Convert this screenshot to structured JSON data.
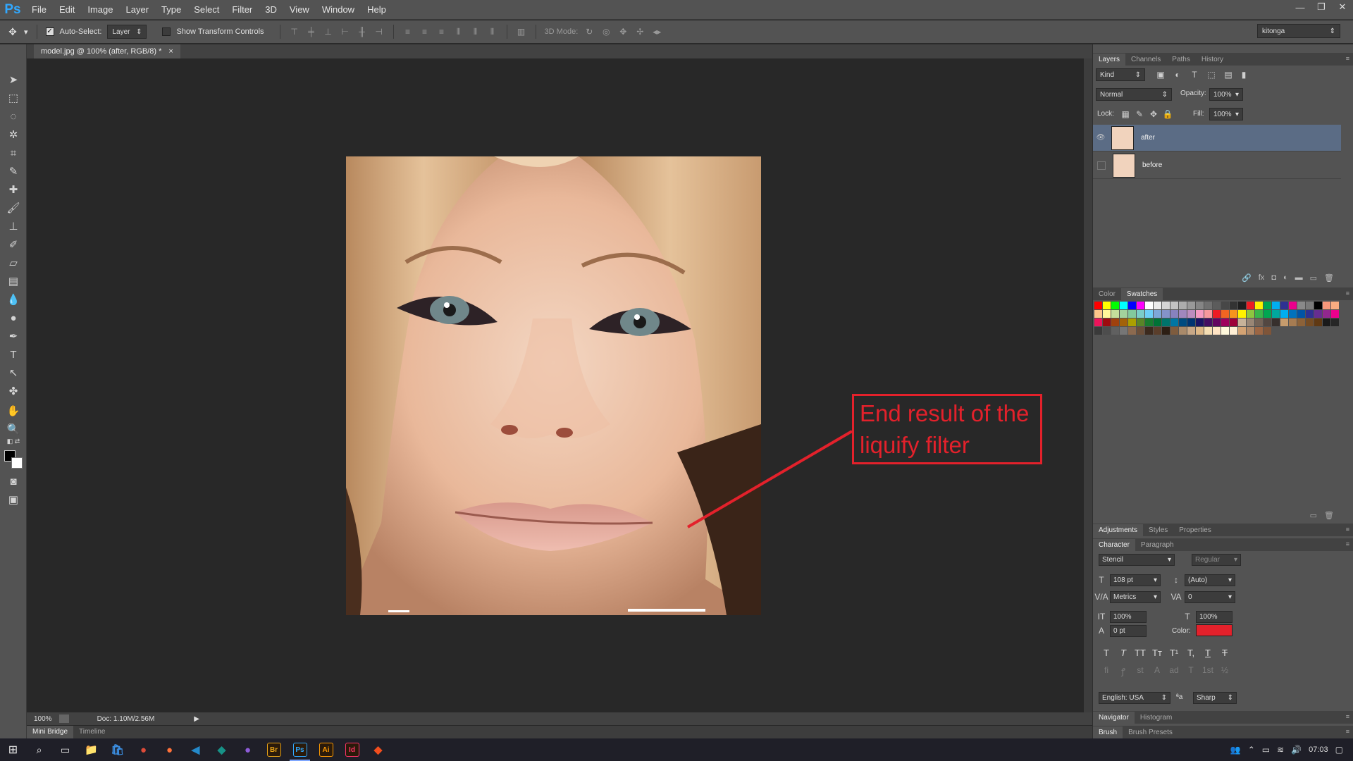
{
  "app": {
    "logo": "Ps",
    "title": "Adobe Photoshop"
  },
  "menu": [
    "File",
    "Edit",
    "Image",
    "Layer",
    "Type",
    "Select",
    "Filter",
    "3D",
    "View",
    "Window",
    "Help"
  ],
  "window_controls": [
    "minimize-icon",
    "restore-icon",
    "close-icon"
  ],
  "options_bar": {
    "auto_select_label": "Auto-Select:",
    "auto_select_checked": true,
    "auto_select_target": "Layer",
    "show_transform_label": "Show Transform Controls",
    "show_transform_checked": false,
    "mode_3d_label": "3D Mode:",
    "workspace": "kitonga"
  },
  "document": {
    "tab_label": "model.jpg @ 100% (after, RGB/8) *",
    "zoom": "100%",
    "doc_size": "Doc: 1.10M/2.56M"
  },
  "annotation": {
    "line1": "End result of the",
    "line2": "liquify filter",
    "color": "#e3212b"
  },
  "bottom_tabs": [
    "Mini Bridge",
    "Timeline"
  ],
  "layers_panel": {
    "tabs": [
      "Layers",
      "Channels",
      "Paths",
      "History"
    ],
    "filter_kind": "Kind",
    "blend_mode": "Normal",
    "opacity_label": "Opacity:",
    "opacity": "100%",
    "lock_label": "Lock:",
    "fill_label": "Fill:",
    "fill": "100%",
    "layers": [
      {
        "name": "after",
        "visible": true,
        "selected": true
      },
      {
        "name": "before",
        "visible": false,
        "selected": false
      }
    ]
  },
  "color_panel": {
    "tabs": [
      "Color",
      "Swatches"
    ]
  },
  "swatches": [
    "#ff0000",
    "#ffff00",
    "#00ff00",
    "#00ffff",
    "#0000ff",
    "#ff00ff",
    "#ffffff",
    "#ebebeb",
    "#d6d6d6",
    "#c2c2c2",
    "#adadad",
    "#999999",
    "#858585",
    "#707070",
    "#5c5c5c",
    "#474747",
    "#333333",
    "#1f1f1f",
    "#ed1c24",
    "#fff200",
    "#00a651",
    "#00aeef",
    "#2e3192",
    "#ec008c",
    "#898989",
    "#7a7a7a",
    "#000000",
    "#f7977a",
    "#f9ad81",
    "#fdc68a",
    "#fff79a",
    "#c4df9b",
    "#a3d39c",
    "#82ca9d",
    "#7bcdc8",
    "#6ecff6",
    "#7ea7d8",
    "#8493ca",
    "#8882be",
    "#a187be",
    "#bc8dbf",
    "#f49ac2",
    "#f6989d",
    "#ed1c24",
    "#f26522",
    "#f7941d",
    "#fff200",
    "#8dc63f",
    "#39b54a",
    "#00a651",
    "#00a99d",
    "#00aeef",
    "#0072bc",
    "#0054a6",
    "#2e3192",
    "#662d91",
    "#92278f",
    "#ec008c",
    "#ed145b",
    "#9e0b0f",
    "#a0410d",
    "#a36209",
    "#aba000",
    "#598527",
    "#197b30",
    "#007236",
    "#00746b",
    "#0076a3",
    "#004b80",
    "#003471",
    "#1b1464",
    "#440e62",
    "#630460",
    "#9e005d",
    "#9e0039",
    "#c7b299",
    "#998675",
    "#736357",
    "#534741",
    "#37302d",
    "#c69c6d",
    "#a67c52",
    "#8c6239",
    "#754c24",
    "#603913",
    "#1a1a1a",
    "#262626",
    "#3a3a3a",
    "#4d4d4d",
    "#606060",
    "#767676",
    "#8c6a4f",
    "#6b4f3a",
    "#3c2a1e",
    "#5a3e2b",
    "#2d1f14",
    "#7e5c3e",
    "#a98a6a",
    "#c8a887",
    "#deb887",
    "#f5deb3",
    "#ffe4c4",
    "#fff8dc",
    "#ffefd5",
    "#d4a373",
    "#b08968",
    "#9c6644",
    "#7f5539"
  ],
  "adjustments_panel": {
    "tabs": [
      "Adjustments",
      "Styles",
      "Properties"
    ]
  },
  "character_panel": {
    "tabs": [
      "Character",
      "Paragraph"
    ],
    "font_family": "Stencil",
    "font_style": "Regular",
    "font_size": "108 pt",
    "leading": "(Auto)",
    "kerning": "Metrics",
    "tracking": "0",
    "vertical_scale": "100%",
    "horizontal_scale": "100%",
    "baseline_shift": "0 pt",
    "color_label": "Color:",
    "color": "#e3212b",
    "language": "English: USA",
    "antialias": "Sharp",
    "type_buttons": [
      "T",
      "T",
      "TT",
      "Tт",
      "T¹",
      "T,",
      "T",
      "T"
    ],
    "opentype_buttons": [
      "fi",
      "ꝭ",
      "st",
      "A",
      "ad",
      "T",
      "1st",
      "½"
    ]
  },
  "navigator_panel": {
    "tabs": [
      "Navigator",
      "Histogram"
    ]
  },
  "brush_panel": {
    "tabs": [
      "Brush",
      "Brush Presets"
    ]
  },
  "taskbar": {
    "apps": [
      {
        "name": "file-explorer",
        "label": "📁",
        "color": "#f3c33c"
      },
      {
        "name": "store",
        "label": "🛍",
        "color": "#3b8de0"
      },
      {
        "name": "chrome",
        "label": "●",
        "color": "#dd4b39"
      },
      {
        "name": "firefox",
        "label": "●",
        "color": "#ff7139"
      },
      {
        "name": "vscode",
        "label": "◀",
        "color": "#2489ca"
      },
      {
        "name": "git-kraken",
        "label": "◆",
        "color": "#179287"
      },
      {
        "name": "media-app",
        "label": "●",
        "color": "#8e5cd9"
      },
      {
        "name": "bridge",
        "label": "Br",
        "color": "#e8a317"
      },
      {
        "name": "photoshop",
        "label": "Ps",
        "color": "#31a8ff"
      },
      {
        "name": "illustrator",
        "label": "Ai",
        "color": "#ff9a00"
      },
      {
        "name": "indesign",
        "label": "Id",
        "color": "#ff3366"
      },
      {
        "name": "figma",
        "label": "◆",
        "color": "#f24e1e"
      }
    ],
    "time": "07:03"
  }
}
